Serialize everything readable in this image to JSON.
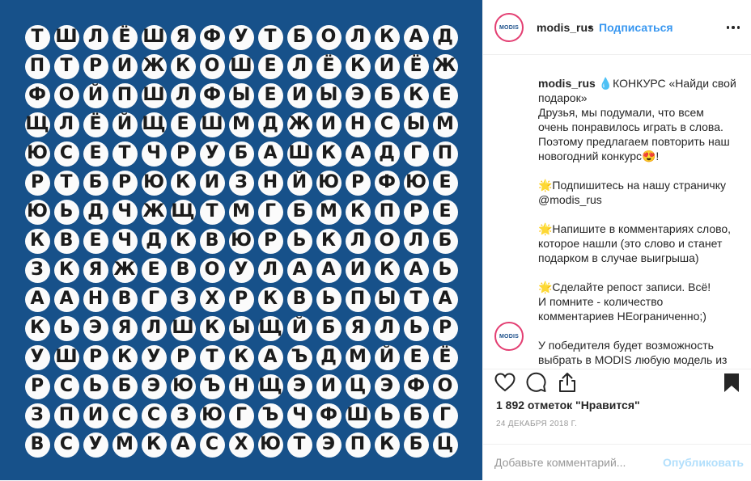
{
  "puzzle": {
    "rows": [
      [
        "Т",
        "Ш",
        "Л",
        "Ё",
        "Ш",
        "Я",
        "Ф",
        "У",
        "Т",
        "Б",
        "О",
        "Л",
        "К",
        "А",
        "Д"
      ],
      [
        "П",
        "Т",
        "Р",
        "И",
        "Ж",
        "К",
        "О",
        "Ш",
        "Е",
        "Л",
        "Ё",
        "К",
        "И",
        "Ё",
        "Ж"
      ],
      [
        "Ф",
        "О",
        "Й",
        "П",
        "Ш",
        "Л",
        "Ф",
        "Ы",
        "Е",
        "И",
        "Ы",
        "Э",
        "Б",
        "К",
        "Е"
      ],
      [
        "Щ",
        "Л",
        "Ё",
        "Й",
        "Щ",
        "Е",
        "Ш",
        "М",
        "Д",
        "Ж",
        "И",
        "Н",
        "С",
        "Ы",
        "М"
      ],
      [
        "Ю",
        "С",
        "Е",
        "Т",
        "Ч",
        "Р",
        "У",
        "Б",
        "А",
        "Ш",
        "К",
        "А",
        "Д",
        "Г",
        "П"
      ],
      [
        "Р",
        "Т",
        "Б",
        "Р",
        "Ю",
        "К",
        "И",
        "З",
        "Н",
        "Й",
        "Ю",
        "Р",
        "Ф",
        "Ю",
        "Е"
      ],
      [
        "Ю",
        "Ь",
        "Д",
        "Ч",
        "Ж",
        "Щ",
        "Т",
        "М",
        "Г",
        "Б",
        "М",
        "К",
        "П",
        "Р",
        "Е"
      ],
      [
        "К",
        "В",
        "Е",
        "Ч",
        "Д",
        "К",
        "В",
        "Ю",
        "Р",
        "Ь",
        "К",
        "Л",
        "О",
        "Л",
        "Б"
      ],
      [
        "З",
        "К",
        "Я",
        "Ж",
        "Е",
        "В",
        "О",
        "У",
        "Л",
        "А",
        "А",
        "И",
        "К",
        "А",
        "Ь"
      ],
      [
        "А",
        "А",
        "Н",
        "В",
        "Г",
        "З",
        "Х",
        "Р",
        "К",
        "В",
        "Ь",
        "П",
        "Ы",
        "Т",
        "А"
      ],
      [
        "К",
        "Ь",
        "Э",
        "Я",
        "Л",
        "Ш",
        "К",
        "Ы",
        "Щ",
        "Й",
        "Б",
        "Я",
        "Л",
        "Ь",
        "Р"
      ],
      [
        "У",
        "Ш",
        "Р",
        "К",
        "У",
        "Р",
        "Т",
        "К",
        "А",
        "Ъ",
        "Д",
        "М",
        "Й",
        "Е",
        "Ё"
      ],
      [
        "Р",
        "С",
        "Ь",
        "Б",
        "Э",
        "Ю",
        "Ъ",
        "Н",
        "Щ",
        "Э",
        "И",
        "Ц",
        "Э",
        "Ф",
        "О"
      ],
      [
        "З",
        "П",
        "И",
        "С",
        "С",
        "З",
        "Ю",
        "Г",
        "Ъ",
        "Ч",
        "Ф",
        "Ш",
        "Ь",
        "Б",
        "Г"
      ],
      [
        "В",
        "С",
        "У",
        "М",
        "К",
        "А",
        "С",
        "Х",
        "Ю",
        "Т",
        "Э",
        "П",
        "К",
        "Б",
        "Ц"
      ]
    ]
  },
  "header": {
    "avatar_text": "MODIS",
    "username": "modis_rus",
    "separator": "•",
    "follow_label": "Подписаться",
    "more_icon": "more-horizontal-icon"
  },
  "caption": {
    "username": "modis_rus",
    "line1": "💧КОНКУРС «Найди свой подарок»",
    "p1": "Друзья, мы подумали, что всем очень понравилось играть в слова. Поэтому предлагаем повторить наш новогодний конкурс😍!",
    "p2": "🌟Подпишитесь на нашу страничку @modis_rus",
    "p3": "🌟Напишите в комментариях слово, которое нашли (это слово и станет подарком в случае выигрыша)",
    "p4": "🌟Сделайте репост записи. Всё!",
    "p5": "И помните - количество комментариев НЕограниченно;)",
    "p6": "У победителя будет возможность выбрать в MODIS любую модель из"
  },
  "reply": {
    "avatar_text": "MODIS"
  },
  "actions": {
    "icons": [
      "heart-icon",
      "comment-icon",
      "share-icon",
      "bookmark-icon"
    ],
    "likes": "1 892 отметок \"Нравится\"",
    "date": "24 ДЕКАБРЯ 2018 Г."
  },
  "comment_box": {
    "placeholder": "Добавьте комментарий...",
    "post_label": "Опубликовать"
  },
  "colors": {
    "puzzle_background": "#17518a",
    "link_blue": "#3897f0",
    "post_disabled": "#b2dffc",
    "avatar_ring": "#e33e72"
  }
}
